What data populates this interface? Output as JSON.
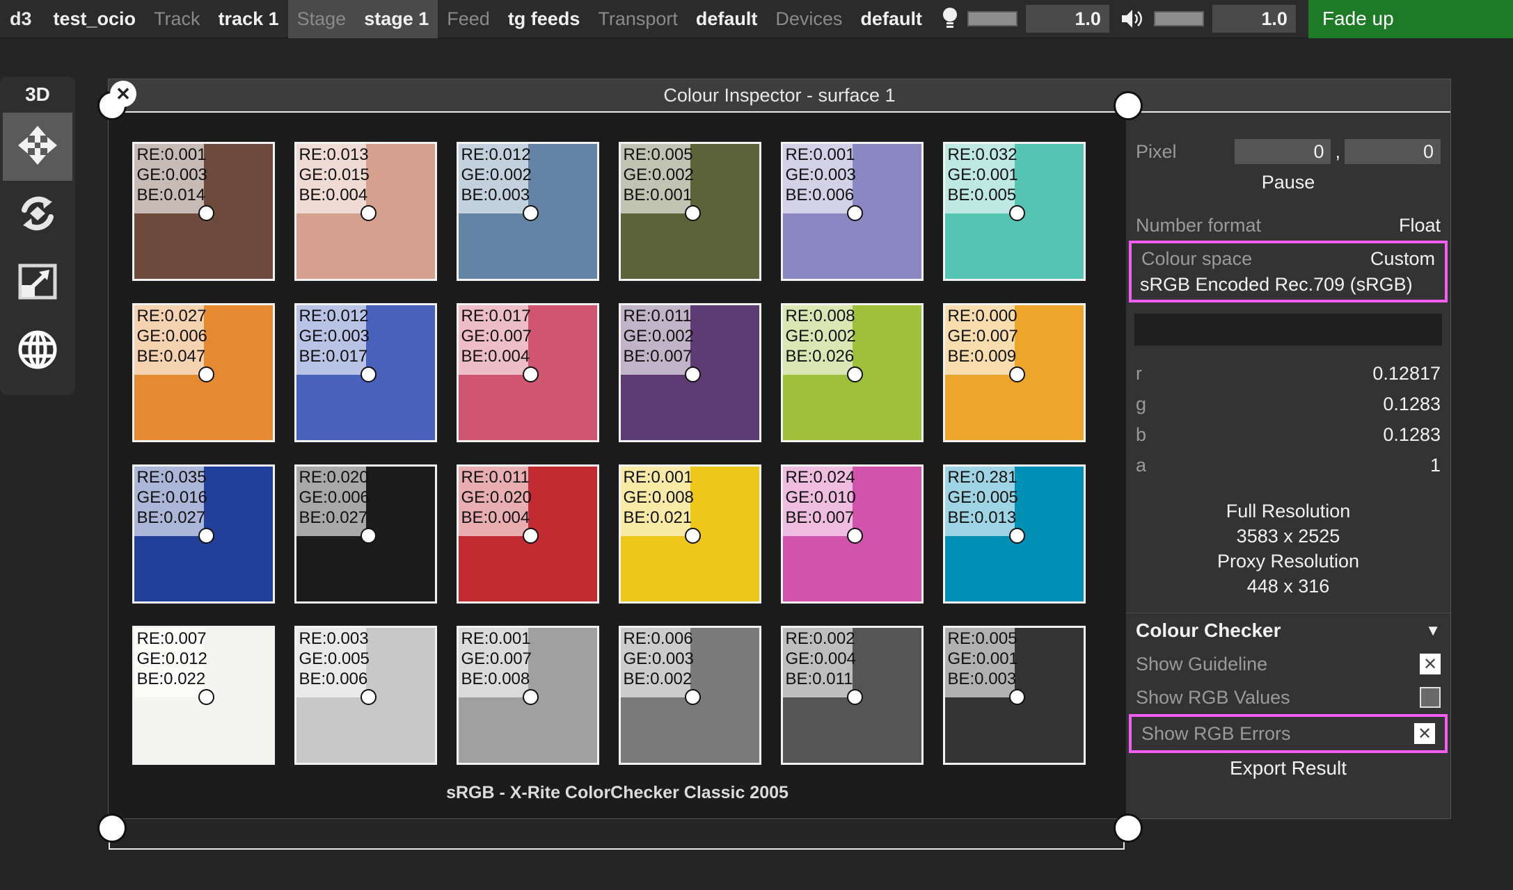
{
  "topbar": {
    "app": "d3",
    "project": "test_ocio",
    "groups": [
      {
        "key": "Track",
        "value": "track 1",
        "active": false
      },
      {
        "key": "Stage",
        "value": "stage 1",
        "active": true
      },
      {
        "key": "Feed",
        "value": "tg feeds",
        "active": false
      },
      {
        "key": "Transport",
        "value": "default",
        "active": false
      },
      {
        "key": "Devices",
        "value": "default",
        "active": false
      }
    ],
    "brightness_icon": "lightbulb-icon",
    "brightness_value": "1.0",
    "volume_icon": "speaker-icon",
    "volume_value": "1.0",
    "fade_up_label": "Fade up",
    "fade_up_color": "#1d7a27"
  },
  "tool3d": {
    "label": "3D",
    "buttons": [
      {
        "icon": "move-icon",
        "selected": true
      },
      {
        "icon": "rotate-icon",
        "selected": false
      },
      {
        "icon": "scale-icon",
        "selected": false
      },
      {
        "icon": "globe-icon",
        "selected": false
      }
    ]
  },
  "inspector": {
    "title": "Colour Inspector - surface 1",
    "close_icon": "close-icon",
    "caption": "sRGB - X-Rite ColorChecker Classic 2005"
  },
  "checker": {
    "patches": [
      {
        "color": "#6e4a3d",
        "re": "RE:0.001",
        "ge": "GE:0.003",
        "be": "BE:0.014"
      },
      {
        "color": "#d6a08f",
        "re": "RE:0.013",
        "ge": "GE:0.015",
        "be": "BE:0.004"
      },
      {
        "color": "#6384a5",
        "re": "RE:0.012",
        "ge": "GE:0.002",
        "be": "BE:0.003"
      },
      {
        "color": "#5c6339",
        "re": "RE:0.005",
        "ge": "GE:0.002",
        "be": "BE:0.001"
      },
      {
        "color": "#8b87c2",
        "re": "RE:0.001",
        "ge": "GE:0.003",
        "be": "BE:0.006"
      },
      {
        "color": "#56c4b2",
        "re": "RE:0.032",
        "ge": "GE:0.001",
        "be": "BE:0.005"
      },
      {
        "color": "#e58a30",
        "re": "RE:0.027",
        "ge": "GE:0.006",
        "be": "BE:0.047"
      },
      {
        "color": "#4861bb",
        "re": "RE:0.012",
        "ge": "GE:0.003",
        "be": "BE:0.017"
      },
      {
        "color": "#cf5570",
        "re": "RE:0.017",
        "ge": "GE:0.007",
        "be": "BE:0.004"
      },
      {
        "color": "#5e3b72",
        "re": "RE:0.011",
        "ge": "GE:0.002",
        "be": "BE:0.007"
      },
      {
        "color": "#9fc03b",
        "re": "RE:0.008",
        "ge": "GE:0.002",
        "be": "BE:0.026"
      },
      {
        "color": "#eda52b",
        "re": "RE:0.000",
        "ge": "GE:0.007",
        "be": "BE:0.009"
      },
      {
        "color": "#22409a",
        "re": "RE:0.035",
        "ge": "GE:0.016",
        "be": "BE:0.027"
      },
      {
        "color": "#47a css",
        "re": "RE:0.020",
        "ge": "GE:0.006",
        "be": "BE:0.027"
      },
      {
        "color": "#c32b33",
        "re": "RE:0.011",
        "ge": "GE:0.020",
        "be": "BE:0.004"
      },
      {
        "color": "#eec71a",
        "re": "RE:0.001",
        "ge": "GE:0.008",
        "be": "BE:0.021"
      },
      {
        "color": "#d153ab",
        "re": "RE:0.024",
        "ge": "GE:0.010",
        "be": "BE:0.007"
      },
      {
        "color": "#008fb5",
        "re": "RE:0.281",
        "ge": "GE:0.005",
        "be": "BE:0.013"
      },
      {
        "color": "#f4f4f0",
        "re": "RE:0.007",
        "ge": "GE:0.012",
        "be": "BE:0.022"
      },
      {
        "color": "#c8c8c8",
        "re": "RE:0.003",
        "ge": "GE:0.005",
        "be": "BE:0.006"
      },
      {
        "color": "#a0a0a0",
        "re": "RE:0.001",
        "ge": "GE:0.007",
        "be": "BE:0.008"
      },
      {
        "color": "#7a7a7a",
        "re": "RE:0.006",
        "ge": "GE:0.003",
        "be": "BE:0.002"
      },
      {
        "color": "#555555",
        "re": "RE:0.002",
        "ge": "GE:0.004",
        "be": "BE:0.011"
      },
      {
        "color": "#343434",
        "re": "RE:0.005",
        "ge": "GE:0.001",
        "be": "BE:0.003"
      }
    ]
  },
  "side": {
    "pixel_label": "Pixel",
    "pixel_x": "0",
    "pixel_sep": ",",
    "pixel_y": "0",
    "pause_label": "Pause",
    "number_format_label": "Number format",
    "number_format_value": "Float",
    "colour_space_label": "Colour space",
    "colour_space_value": "Custom",
    "colour_space_full": "sRGB Encoded Rec.709 (sRGB)",
    "highlight_color": "#f45ef4",
    "channels": [
      {
        "key": "r",
        "value": "0.12817"
      },
      {
        "key": "g",
        "value": "0.1283"
      },
      {
        "key": "b",
        "value": "0.1283"
      },
      {
        "key": "a",
        "value": "1"
      }
    ],
    "full_res_label": "Full Resolution",
    "full_res_value": "3583 x 2525",
    "proxy_res_label": "Proxy Resolution",
    "proxy_res_value": "448 x 316",
    "cc_title": "Colour Checker",
    "cc_caret": "▼",
    "options": [
      {
        "label": "Show Guideline",
        "checked": true,
        "mark": "✕"
      },
      {
        "label": "Show RGB Values",
        "checked": false,
        "mark": ""
      },
      {
        "label": "Show RGB Errors",
        "checked": true,
        "mark": "✕",
        "highlight": true
      }
    ],
    "export_label": "Export Result"
  }
}
